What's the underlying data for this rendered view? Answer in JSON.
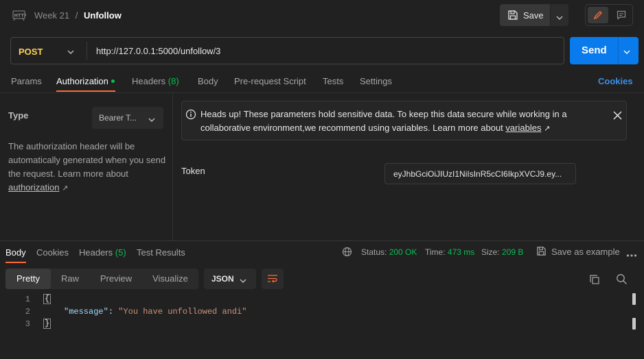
{
  "header": {
    "breadcrumb_parent": "Week 21",
    "breadcrumb_sep": "/",
    "breadcrumb_current": "Unfollow",
    "save_label": "Save"
  },
  "request": {
    "method": "POST",
    "url": "http://127.0.0.1:5000/unfollow/3",
    "send_label": "Send"
  },
  "tabs": {
    "params": "Params",
    "authorization": "Authorization",
    "headers": "Headers",
    "headers_count": "(8)",
    "body": "Body",
    "prerequest": "Pre-request Script",
    "tests": "Tests",
    "settings": "Settings",
    "cookies": "Cookies"
  },
  "auth": {
    "type_label": "Type",
    "type_value": "Bearer T...",
    "desc_line1": "The authorization header will be",
    "desc_line2": "automatically generated when you send",
    "desc_line3": "the request. Learn more about",
    "desc_link": "authorization",
    "warning_line1": "Heads up! These parameters hold sensitive data. To keep this data secure while working in a",
    "warning_line2": "collaborative environment,we recommend using variables. Learn more about",
    "warning_link": "variables",
    "token_label": "Token",
    "token_value": "eyJhbGciOiJIUzI1NiIsInR5cCI6IkpXVCJ9.ey..."
  },
  "response": {
    "tabs": {
      "body": "Body",
      "cookies": "Cookies",
      "headers": "Headers",
      "headers_count": "(5)",
      "test_results": "Test Results"
    },
    "status_label": "Status:",
    "status_value": "200 OK",
    "time_label": "Time:",
    "time_value": "473 ms",
    "size_label": "Size:",
    "size_value": "209 B",
    "save_example": "Save as example",
    "views": [
      "Pretty",
      "Raw",
      "Preview",
      "Visualize"
    ],
    "format": "JSON",
    "code": {
      "line_numbers": [
        "1",
        "2",
        "3"
      ],
      "open_brace": "{",
      "close_brace": "}",
      "key": "\"message\"",
      "colon": ": ",
      "value": "\"You have unfollowed andi\""
    }
  },
  "colors": {
    "accent": "#ff6c37",
    "send": "#097bed",
    "method_post": "#ffd25a",
    "ok_green": "#0cbb52",
    "link_blue": "#3a8ee6"
  }
}
